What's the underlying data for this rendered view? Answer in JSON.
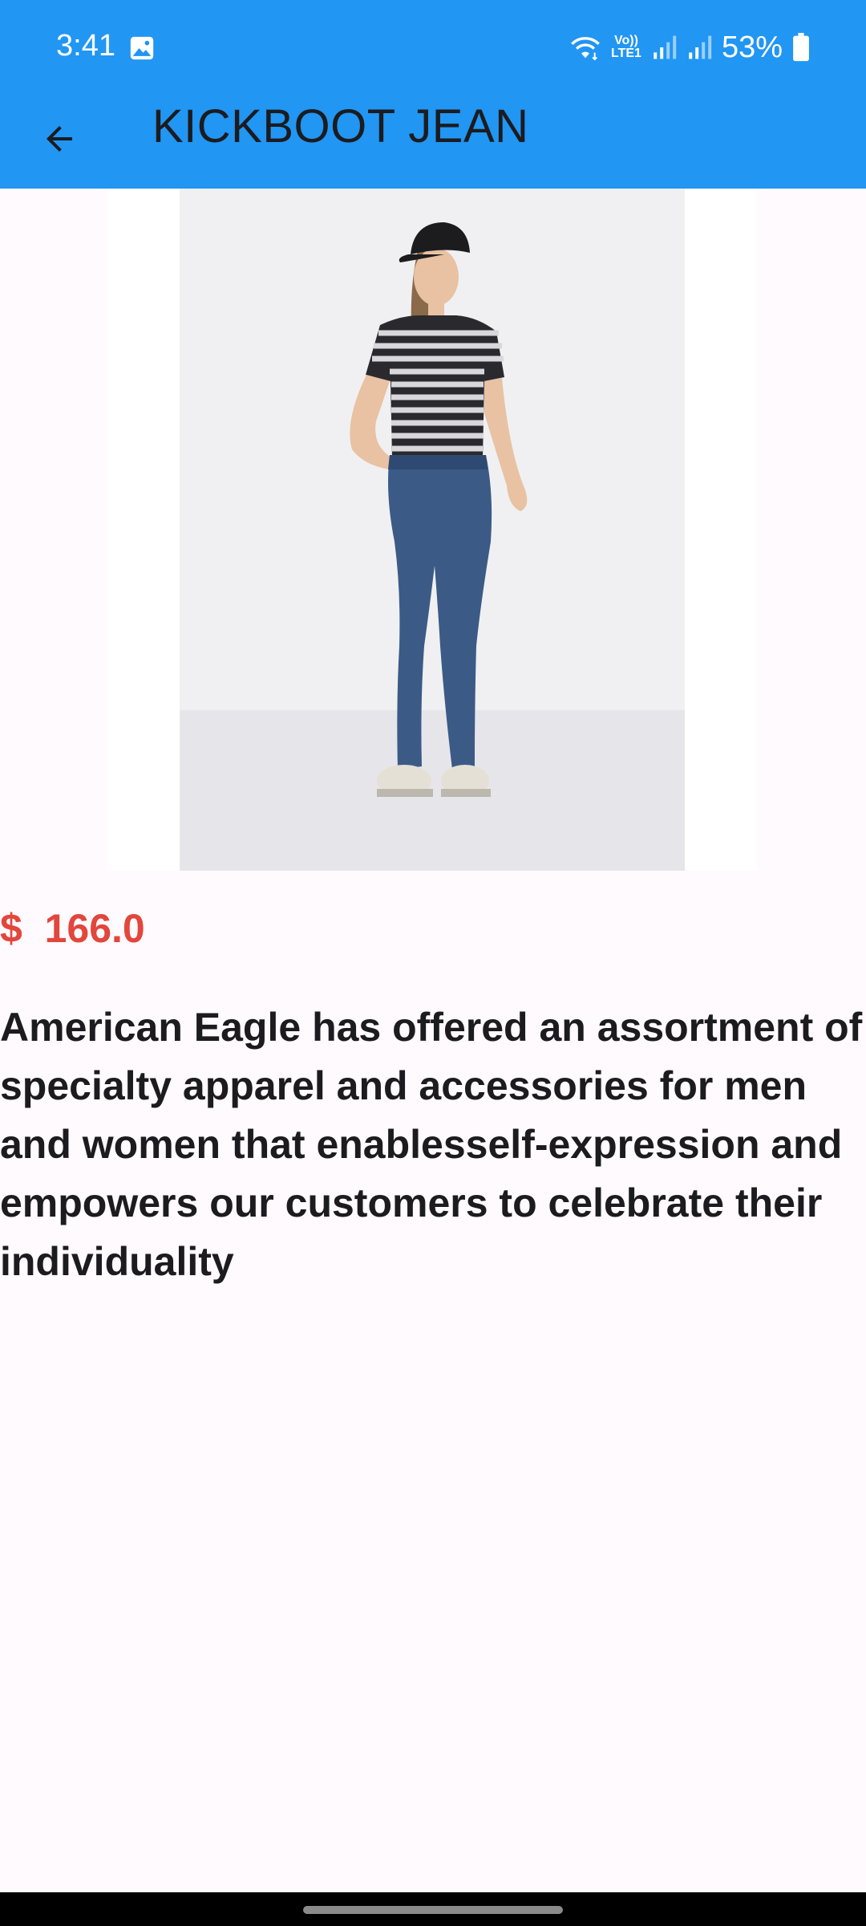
{
  "status_bar": {
    "time": "3:41",
    "battery": "53%",
    "network_label_top": "Vo))",
    "network_label_bottom": "LTE1",
    "icons": [
      "gallery-icon",
      "wifi-icon",
      "volte-icon",
      "signal-icon",
      "signal-icon",
      "battery-icon"
    ]
  },
  "toolbar": {
    "title": "KICKBOOT JEAN",
    "back_icon": "arrow-back-icon"
  },
  "product": {
    "image_alt": "model wearing striped t-shirt, black cap and bootcut jeans",
    "price": "$  166.0",
    "description": "American Eagle has offered an assortment of specialty apparel and accessories for men and women that enablesself-expression and empowers our customers to celebrate their individuality"
  },
  "colors": {
    "app_bar": "#2196f3",
    "price": "#e2463c",
    "text": "#1c1b1f",
    "background": "#fefafd"
  }
}
